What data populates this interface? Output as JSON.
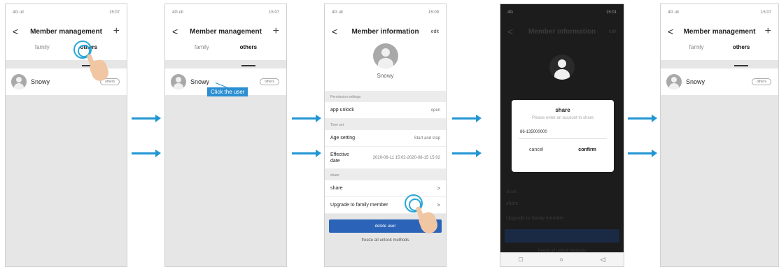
{
  "screen1": {
    "status": {
      "left": "4G ull",
      "right": "15:07"
    },
    "header": {
      "back": "<",
      "title": "Member management",
      "add": "+"
    },
    "tabs": [
      "family",
      "others"
    ],
    "user": {
      "name": "Snowy",
      "badge": "others"
    }
  },
  "screen2": {
    "status": {
      "left": "4G ull",
      "right": "15:07"
    },
    "header": {
      "back": "<",
      "title": "Member management",
      "add": "+"
    },
    "tabs": [
      "family",
      "others"
    ],
    "user": {
      "name": "Snowy",
      "badge": "others"
    },
    "annotation": "Click the user"
  },
  "screen3": {
    "status": {
      "left": "4G ull",
      "right": "15:09"
    },
    "header": {
      "back": "<",
      "title": "Member information",
      "edit": "edit"
    },
    "name": "Snowy",
    "sections": {
      "permission": "Permission settings",
      "time": "Time set",
      "share": "share"
    },
    "app_unlock": {
      "label": "app unlock",
      "value": "open"
    },
    "age_setting": {
      "label": "Age setting",
      "value": "Start and stop"
    },
    "effective_date": {
      "label": "Effective date",
      "value": "2020-08-11 15:02-2020-08-15 15:02"
    },
    "share_item": "share",
    "upgrade_item": "Upgrade to family member",
    "chevron": ">",
    "delete_label": "delete user",
    "freeze_label": "freeze all unlock methods"
  },
  "screen4": {
    "status": {
      "left": "4G",
      "right": "15:01"
    },
    "dim_title": "Member information",
    "dim_edit": "edit",
    "dim_share": "share",
    "dim_upgrade": "Upgrade to family member",
    "dim_freeze": "freeze all unlock methods",
    "dialog": {
      "title": "share",
      "hint": "Please enter an account to share",
      "account": "86-135000000",
      "cancel": "cancel",
      "confirm": "confirm"
    },
    "nav": {
      "home": "□",
      "circle": "○",
      "back": "◁"
    }
  },
  "screen5": {
    "status": {
      "left": "4G ull",
      "right": "15:07"
    },
    "header": {
      "back": "<",
      "title": "Member management",
      "add": "+"
    },
    "tabs": [
      "family",
      "others"
    ],
    "user": {
      "name": "Snowy",
      "badge": "others"
    }
  },
  "colors": {
    "arrow": "#2196d3",
    "accent": "#2b63b8",
    "tap": "#29a7d8"
  }
}
